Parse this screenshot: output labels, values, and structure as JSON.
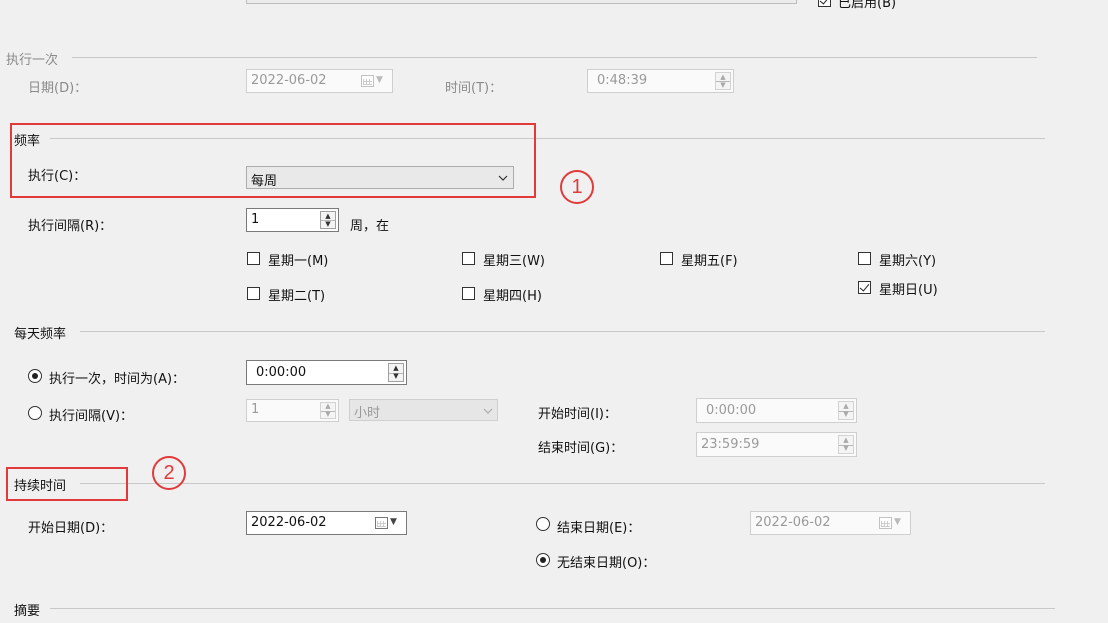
{
  "top": {
    "enabled_label": "已启用(B)",
    "enabled_checked": true
  },
  "run_once": {
    "section_title": "执行一次",
    "date_label": "日期(D)：",
    "date_value": "2022-06-02",
    "time_label": "时间(T)：",
    "time_value": "0:48:39"
  },
  "frequency": {
    "section_title": "频率",
    "execute_label": "执行(C)：",
    "execute_value": "每周",
    "interval_label": "执行间隔(R)：",
    "interval_value": "1",
    "interval_suffix": "周，在",
    "days": [
      {
        "label": "星期一(M)",
        "checked": false
      },
      {
        "label": "星期三(W)",
        "checked": false
      },
      {
        "label": "星期五(F)",
        "checked": false
      },
      {
        "label": "星期六(Y)",
        "checked": false
      },
      {
        "label": "星期二(T)",
        "checked": false
      },
      {
        "label": "星期四(H)",
        "checked": false
      },
      {
        "label": "星期日(U)",
        "checked": true
      }
    ]
  },
  "daily": {
    "section_title": "每天频率",
    "once_label": "执行一次，时间为(A)：",
    "once_value": "0:00:00",
    "once_selected": true,
    "interval_label": "执行间隔(V)：",
    "interval_value": "1",
    "interval_unit": "小时",
    "interval_selected": false,
    "start_label": "开始时间(I)：",
    "start_value": "0:00:00",
    "end_label": "结束时间(G)：",
    "end_value": "23:59:59"
  },
  "duration": {
    "section_title": "持续时间",
    "start_label": "开始日期(D)：",
    "start_value": "2022-06-02",
    "end_label": "结束日期(E)：",
    "end_value": "2022-06-02",
    "end_selected": false,
    "no_end_label": "无结束日期(O)：",
    "no_end_selected": true
  },
  "summary": {
    "section_title": "摘要"
  },
  "annotations": {
    "mark1": "1",
    "mark2": "2",
    "color": "#e03a3a"
  }
}
